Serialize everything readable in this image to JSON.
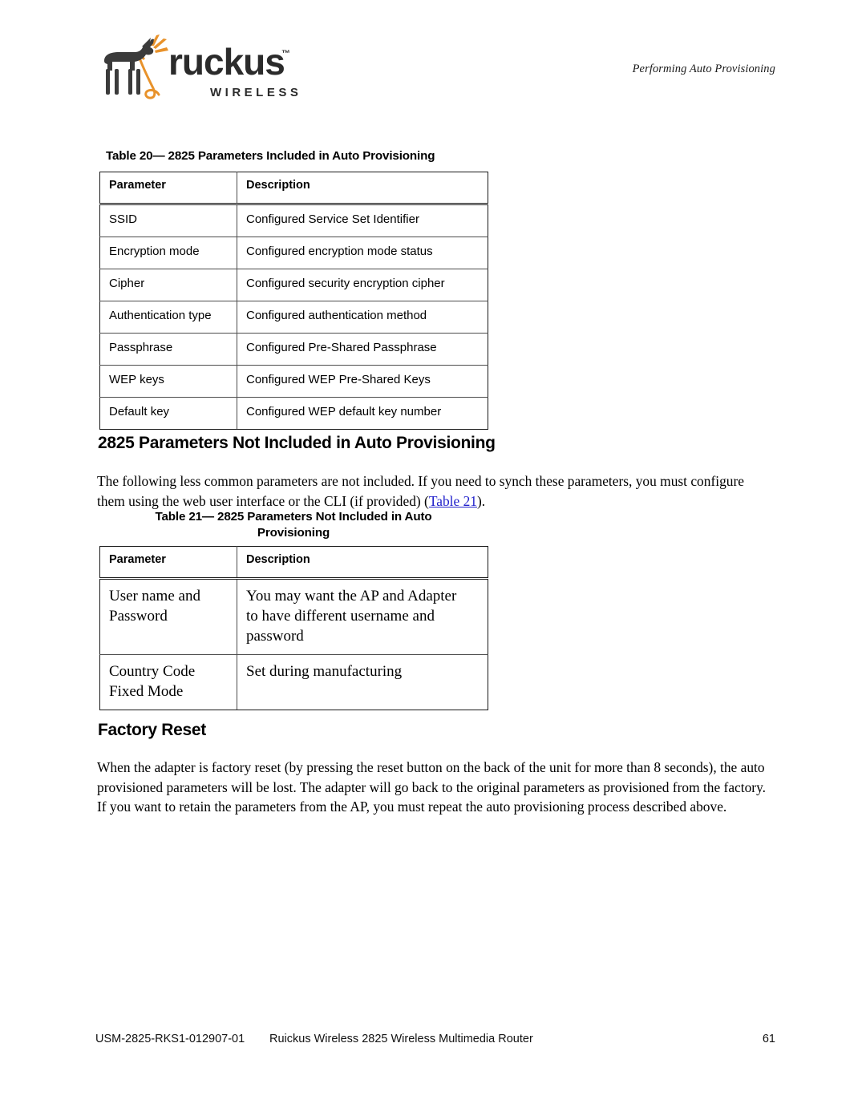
{
  "header": {
    "running_head": "Performing Auto Provisioning",
    "logo": {
      "wordmark": "ruckus",
      "trademark": "™",
      "subtext": "WIRELESS",
      "dog_color": "#3b3b3b",
      "leash_color": "#e8922b"
    }
  },
  "table_20": {
    "caption": "Table 20— 2825 Parameters Included in Auto Provisioning",
    "columns": [
      "Parameter",
      "Description"
    ],
    "rows": [
      [
        "SSID",
        "Configured Service Set Identifier"
      ],
      [
        "Encryption mode",
        "Configured encryption mode status"
      ],
      [
        "Cipher",
        "Configured security encryption cipher"
      ],
      [
        "Authentication type",
        "Configured authentication method"
      ],
      [
        "Passphrase",
        "Configured Pre-Shared Passphrase"
      ],
      [
        "WEP keys",
        "Configured WEP Pre-Shared Keys"
      ],
      [
        "Default key",
        "Configured WEP default key number"
      ]
    ]
  },
  "section_not_included": {
    "heading": "2825 Parameters Not Included in Auto Provisioning",
    "paragraph_part1": "The following less common parameters are not included. If you need to synch these parameters, you must configure them using the web user interface or the CLI (if provided) (",
    "link_text": "Table 21",
    "paragraph_part2": ")."
  },
  "table_21": {
    "caption_line1": "Table 21— 2825 Parameters Not Included in Auto",
    "caption_line2": "Provisioning",
    "columns": [
      "Parameter",
      "Description"
    ],
    "rows": [
      {
        "parameter_lines": [
          "User name and",
          "Password"
        ],
        "description_lines": [
          "You may want the AP and Adapter",
          "to have different username and",
          "password"
        ]
      },
      {
        "parameter_lines": [
          "Country Code",
          "Fixed Mode"
        ],
        "description_lines": [
          "Set during manufacturing"
        ]
      }
    ]
  },
  "section_factory_reset": {
    "heading": "Factory Reset",
    "paragraph": "When the adapter is factory reset (by pressing the reset button on the back of the unit for more than 8 seconds), the auto provisioned parameters will be lost. The adapter will go back to the original parameters as provisioned from the factory. If you want to retain the parameters from the AP, you must repeat the auto provisioning process described above."
  },
  "footer": {
    "doc_number": "USM-2825-RKS1-012907-01",
    "title": "Ruickus Wireless 2825 Wireless Multimedia Router",
    "page_number": "61"
  }
}
